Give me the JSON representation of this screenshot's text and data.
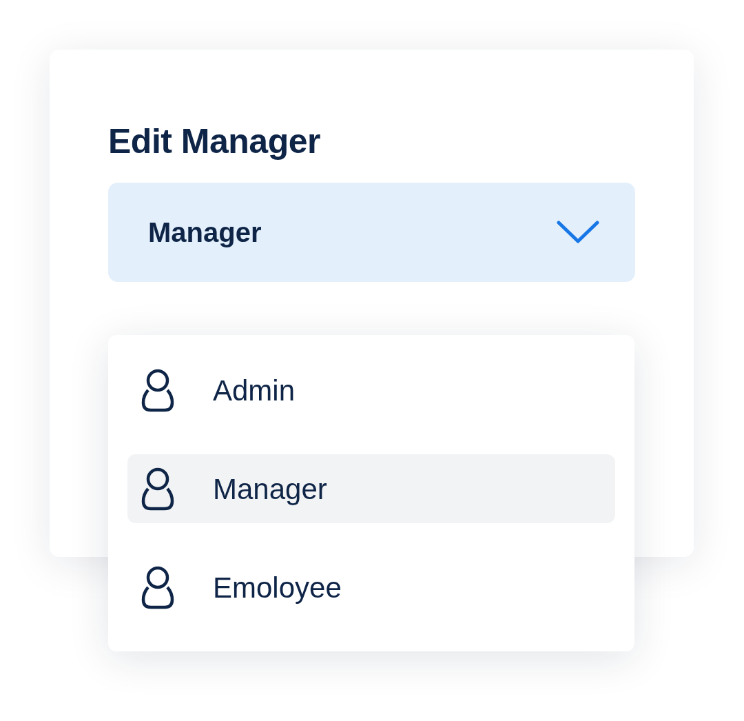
{
  "title": "Edit Manager",
  "select": {
    "value": "Manager",
    "expanded": true
  },
  "options": [
    {
      "label": "Admin",
      "selected": false
    },
    {
      "label": "Manager",
      "selected": true
    },
    {
      "label": "Emoloyee",
      "selected": false
    }
  ]
}
